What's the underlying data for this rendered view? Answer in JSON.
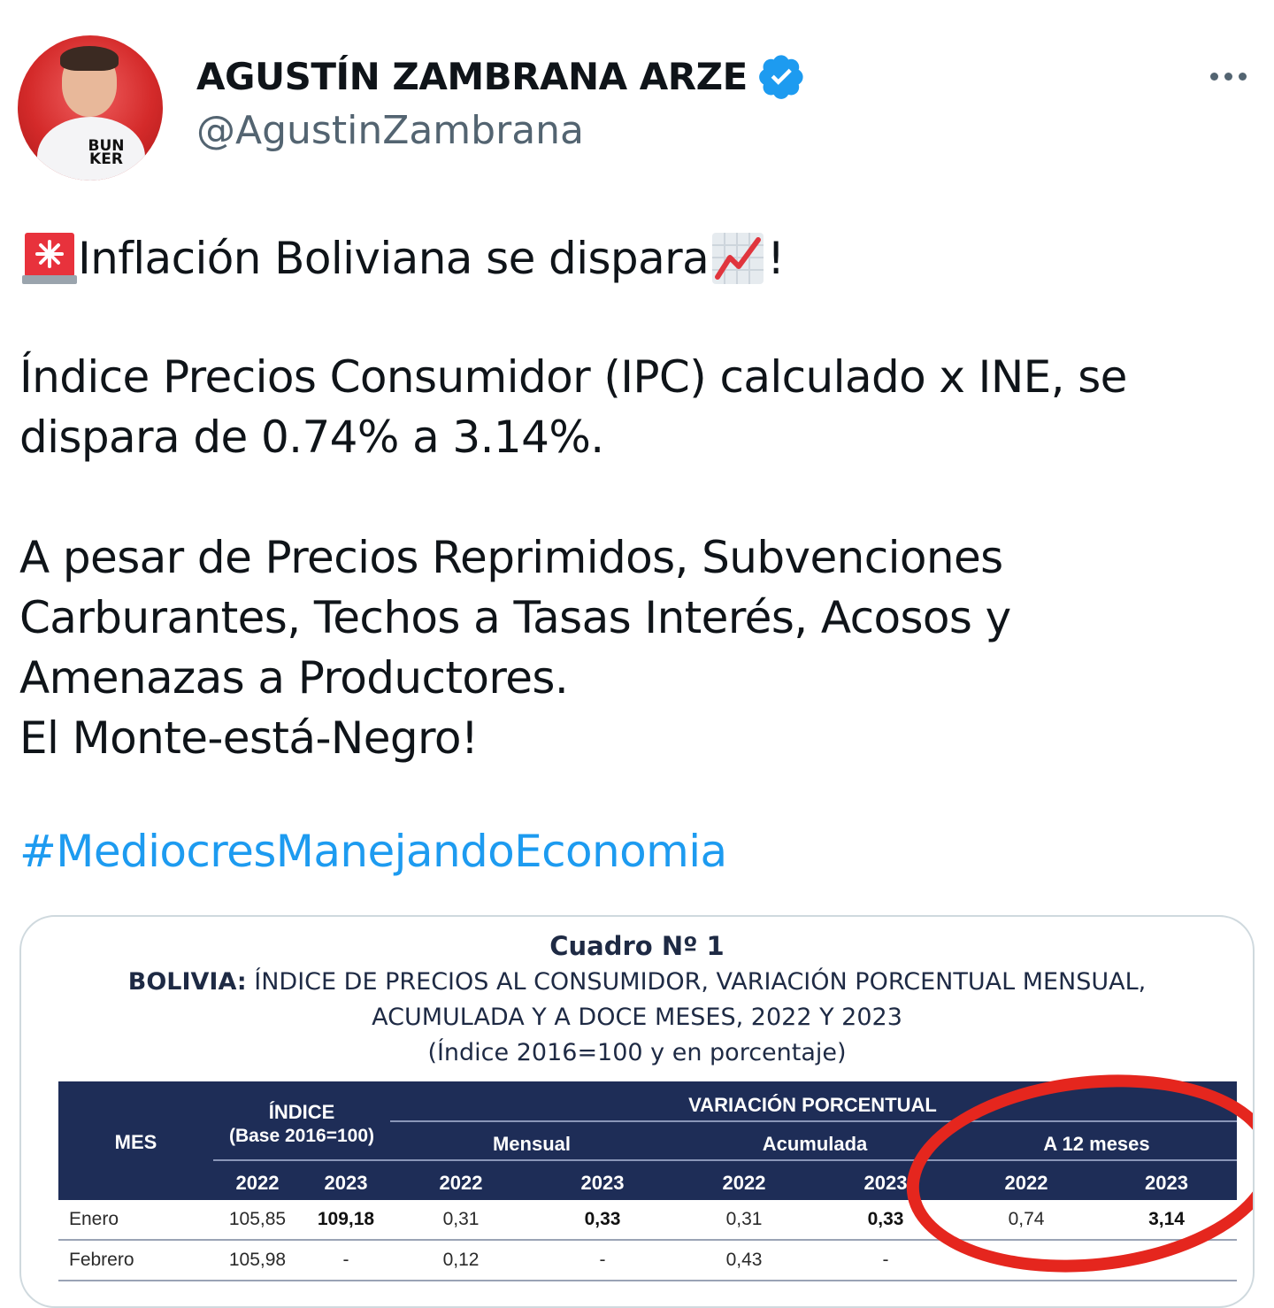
{
  "author": {
    "name": "AGUSTÍN ZAMBRANA ARZE",
    "handle": "@AgustinZambrana",
    "avatar_logo_top": "BUN",
    "avatar_logo_bottom": "KER",
    "verified_color": "#1d9bf0"
  },
  "tweet": {
    "line1_text": "Inflación Boliviana se dispara",
    "line1_end": "!",
    "line1_emoji_start": "police-light-emoji",
    "line1_emoji_mid": "chart-increasing-emoji",
    "para2": "Índice Precios Consumidor (IPC) calculado x INE, se dispara de 0.74% a 3.14%.",
    "para3_lines": [
      "A pesar de Precios Reprimidos, Subvenciones",
      "Carburantes, Techos a Tasas Interés, Acosos y",
      "Amenazas a Productores.",
      "El Monte-está-Negro!"
    ],
    "hashtag": "#MediocresManejandoEconomia",
    "link_color": "#1d9bf0"
  },
  "media": {
    "title": "Cuadro Nº 1",
    "subtitle_bold": "BOLIVIA:",
    "subtitle_rest": " ÍNDICE DE PRECIOS AL CONSUMIDOR, VARIACIÓN PORCENTUAL MENSUAL,",
    "subtitle_line2": "ACUMULADA Y A DOCE MESES, 2022 Y 2023",
    "subtitle_line3": "(Índice 2016=100 y en porcentaje)",
    "header": {
      "mes": "MES",
      "indice": "ÍNDICE",
      "indice_base": "(Base 2016=100)",
      "variacion": "VARIACIÓN PORCENTUAL",
      "mensual": "Mensual",
      "acumulada": "Acumulada",
      "doce": "A 12 meses",
      "years": [
        "2022",
        "2023",
        "2022",
        "2023",
        "2022",
        "2023",
        "2022",
        "2023"
      ]
    },
    "rows": [
      {
        "mes": "Enero",
        "vals": [
          "105,85",
          "109,18",
          "0,31",
          "0,33",
          "0,31",
          "0,33",
          "0,74",
          "3,14"
        ]
      },
      {
        "mes": "Febrero",
        "vals": [
          "105,98",
          "-",
          "0,12",
          "-",
          "0,43",
          "-",
          "",
          ""
        ]
      }
    ],
    "header_color": "#1e2d57",
    "annotation_color": "#e5261e"
  }
}
